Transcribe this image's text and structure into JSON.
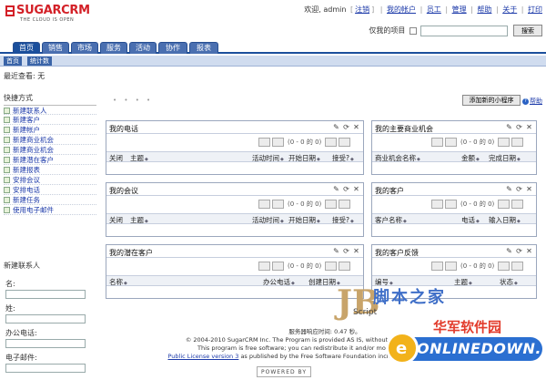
{
  "header": {
    "logo_word": "SUGARCRM",
    "logo_tagline": "THE CLOUD IS OPEN",
    "welcome": "欢迎, admin",
    "logout": "注销",
    "links": [
      "我的帐户",
      "员工",
      "管理",
      "帮助",
      "关于",
      "打印"
    ],
    "extra_link": "帮助",
    "search_label": "仅我的项目",
    "search_placeholder": "",
    "search_button": "搜索"
  },
  "tabs": [
    "首页",
    "销售",
    "市场",
    "服务",
    "活动",
    "协作",
    "报表"
  ],
  "subtabs": [
    "首页",
    "统计数"
  ],
  "breadcrumb": "最近查看: 无",
  "sidebar": {
    "actions_title": "快捷方式",
    "items": [
      "新建联系人",
      "新建客户",
      "新建帐户",
      "新建商业机会",
      "新建商业机会",
      "新建潜在客户",
      "新建报表",
      "安排会议",
      "安排电话",
      "新建任务",
      "使用电子邮件"
    ],
    "quick_create_title": "新建联系人",
    "quick_fields": [
      "名:",
      "姓:",
      "办公电话:",
      "电子邮件:"
    ]
  },
  "main": {
    "add_dashlet": "添加新的小程序",
    "help": "帮助",
    "dashlets": [
      {
        "title": "我的电话",
        "paging": "(0 - 0 的 0)",
        "columns": [
          "关闭",
          "主题",
          "活动时间",
          "开始日期",
          "接受?"
        ]
      },
      {
        "title": "我的主要商业机会",
        "paging": "(0 - 0 的 0)",
        "columns": [
          "商业机会名称",
          "金额",
          "完成日期"
        ]
      },
      {
        "title": "我的会议",
        "paging": "(0 - 0 的 0)",
        "columns": [
          "关闭",
          "主题",
          "活动时间",
          "开始日期",
          "接受?"
        ]
      },
      {
        "title": "我的客户",
        "paging": "(0 - 0 的 0)",
        "columns": [
          "客户名称",
          "电话",
          "输入日期"
        ]
      },
      {
        "title": "我的潜在客户",
        "paging": "(0 - 0 的 0)",
        "columns": [
          "名称",
          "办公电话",
          "创建日期"
        ]
      },
      {
        "title": "我的客户反馈",
        "paging": "(0 - 0 的 0)",
        "columns": [
          "编号",
          "主题",
          "状态"
        ]
      }
    ]
  },
  "footer": {
    "line1": "服务器响应时间: 0.47 秒。",
    "line2": "© 2004-2010 SugarCRM Inc. The Program is provided AS IS, without warranty. Licensed under",
    "line3": "This program is free software; you can redistribute it and/or modify it under the terms",
    "line4_link": "Public License version 3",
    "line4_rest": "as published by the Free Software Foundation including the additional permission",
    "powered": "POWERED BY"
  },
  "watermarks": {
    "wm1_letters": "JB",
    "wm1_cn": "脚本之家",
    "wm1_en": "Script",
    "wm2_cn": "华军软件园",
    "wm2_en": "ONLINEDOWN.net"
  },
  "colors": {
    "brand_red": "#d32027",
    "tab_blue": "#1b4f9c",
    "link_blue": "#1c3aa9"
  }
}
